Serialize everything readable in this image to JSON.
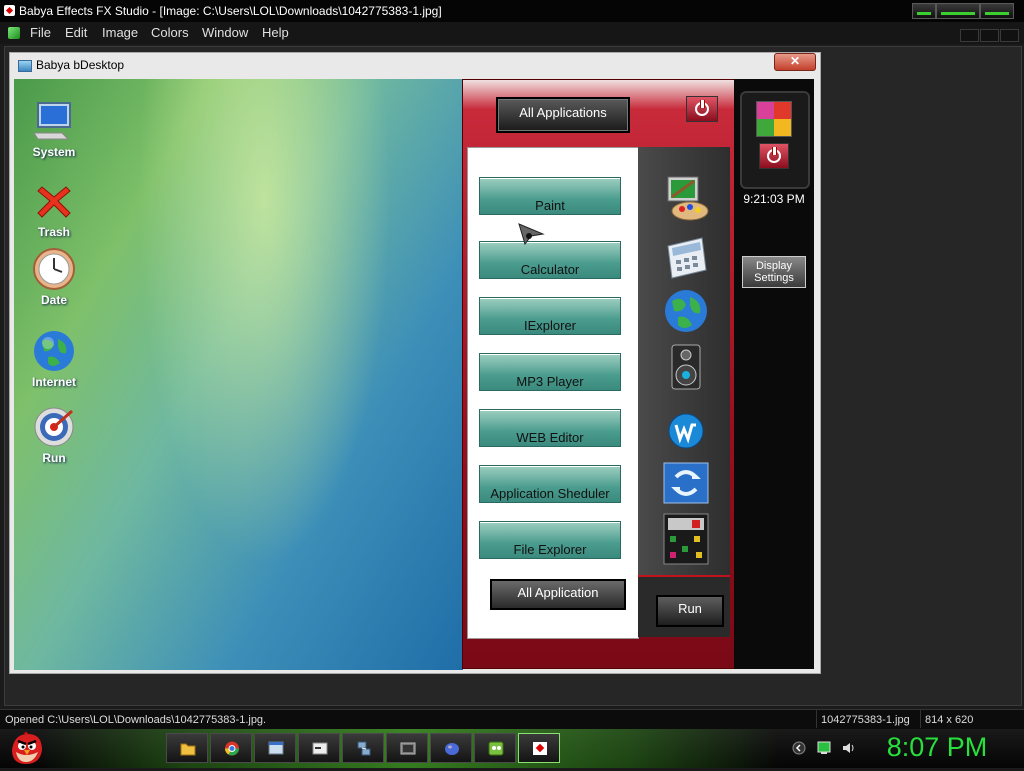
{
  "app": {
    "title": "Babya Effects FX Studio - [Image: C:\\Users\\LOL\\Downloads\\1042775383-1.jpg]"
  },
  "menu": [
    "File",
    "Edit",
    "Image",
    "Colors",
    "Window",
    "Help"
  ],
  "image_window": {
    "title": "Babya bDesktop",
    "close_label": "✕"
  },
  "desktop": {
    "icons": [
      {
        "label": "System",
        "icon": "monitor-icon"
      },
      {
        "label": "Trash",
        "icon": "trash-x-icon"
      },
      {
        "label": "Date",
        "icon": "clock-icon"
      },
      {
        "label": "Internet",
        "icon": "globe-icon"
      },
      {
        "label": "Run",
        "icon": "target-icon"
      }
    ]
  },
  "start_panel": {
    "all_applications_label": "All Applications",
    "apps": [
      "Paint",
      "Calculator",
      "IExplorer",
      "MP3 Player",
      "WEB Editor",
      "Application Sheduler",
      "File Explorer"
    ],
    "all_application_label": "All Application",
    "run_label": "Run",
    "side_icons": [
      "paint-palette-icon",
      "calculator-icon",
      "globe-icon",
      "speaker-icon",
      "web-editor-icon",
      "sync-icon",
      "file-explorer-icon"
    ]
  },
  "right_panel": {
    "time": "9:21:03 PM",
    "display_settings_label": "Display Settings"
  },
  "status": {
    "message": "Opened C:\\Users\\LOL\\Downloads\\1042775383-1.jpg.",
    "filename": "1042775383-1.jpg",
    "dimensions": "814 x 620"
  },
  "taskbar": {
    "clock": "8:07 PM",
    "items": [
      "folder-icon",
      "chrome-icon",
      "window-icon",
      "console-icon",
      "network-icon",
      "media-icon",
      "ball-icon",
      "game-icon",
      "app-icon"
    ]
  },
  "colors": {
    "accent_green": "#27e03c",
    "panel_red": "#9b0e1e"
  }
}
